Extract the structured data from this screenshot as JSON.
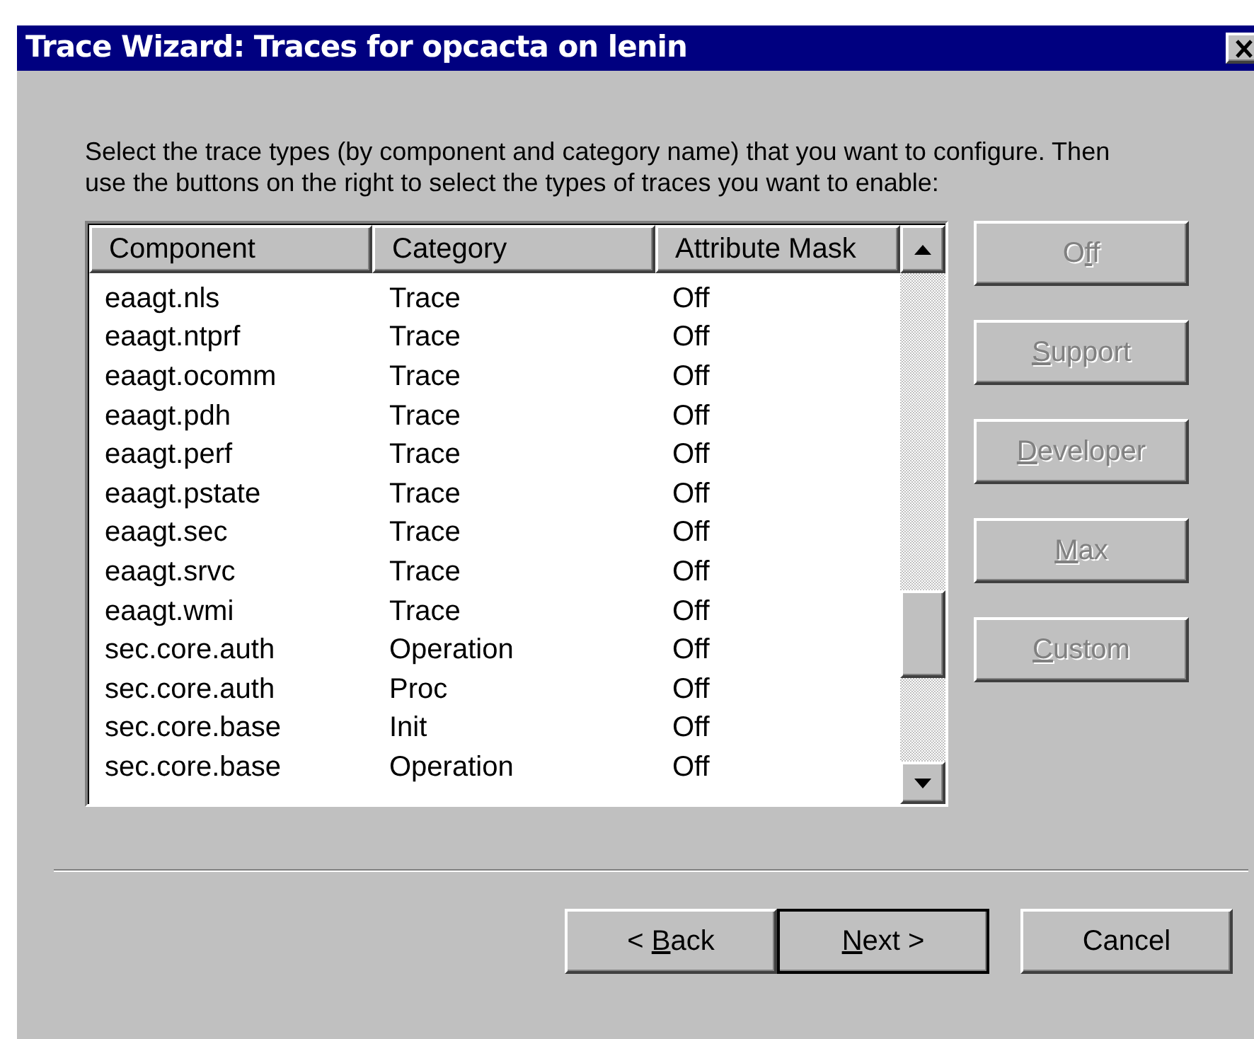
{
  "window": {
    "title": "Trace Wizard: Traces for opcacta on lenin"
  },
  "instructions": "Select the trace types (by component and category name) that you want to configure.  Then use the buttons on the right to select the types of traces you want to enable:",
  "table": {
    "columns": [
      "Component",
      "Category",
      "Attribute Mask"
    ],
    "rows": [
      {
        "component": "eaagt.nls",
        "category": "Trace",
        "attribute_mask": "Off"
      },
      {
        "component": "eaagt.ntprf",
        "category": "Trace",
        "attribute_mask": "Off"
      },
      {
        "component": "eaagt.ocomm",
        "category": "Trace",
        "attribute_mask": "Off"
      },
      {
        "component": "eaagt.pdh",
        "category": "Trace",
        "attribute_mask": "Off"
      },
      {
        "component": "eaagt.perf",
        "category": "Trace",
        "attribute_mask": "Off"
      },
      {
        "component": "eaagt.pstate",
        "category": "Trace",
        "attribute_mask": "Off"
      },
      {
        "component": "eaagt.sec",
        "category": "Trace",
        "attribute_mask": "Off"
      },
      {
        "component": "eaagt.srvc",
        "category": "Trace",
        "attribute_mask": "Off"
      },
      {
        "component": "eaagt.wmi",
        "category": "Trace",
        "attribute_mask": "Off"
      },
      {
        "component": "sec.core.auth",
        "category": "Operation",
        "attribute_mask": "Off"
      },
      {
        "component": "sec.core.auth",
        "category": "Proc",
        "attribute_mask": "Off"
      },
      {
        "component": "sec.core.base",
        "category": "Init",
        "attribute_mask": "Off"
      },
      {
        "component": "sec.core.base",
        "category": "Operation",
        "attribute_mask": "Off"
      }
    ]
  },
  "trace_buttons": [
    {
      "label_before": "O",
      "access_key": "f",
      "label_after": "f",
      "disabled": true
    },
    {
      "access_key": "S",
      "label_after": "upport",
      "disabled": true
    },
    {
      "access_key": "D",
      "label_after": "eveloper",
      "disabled": true
    },
    {
      "access_key": "M",
      "label_after": "ax",
      "disabled": true
    },
    {
      "access_key": "C",
      "label_after": "ustom",
      "disabled": true
    }
  ],
  "nav_buttons": [
    {
      "label_before": "< ",
      "access_key": "B",
      "label_after": "ack",
      "default": false
    },
    {
      "access_key": "N",
      "label_after": "ext >",
      "default": true
    },
    {
      "label_before": "Cancel",
      "default": false
    }
  ]
}
